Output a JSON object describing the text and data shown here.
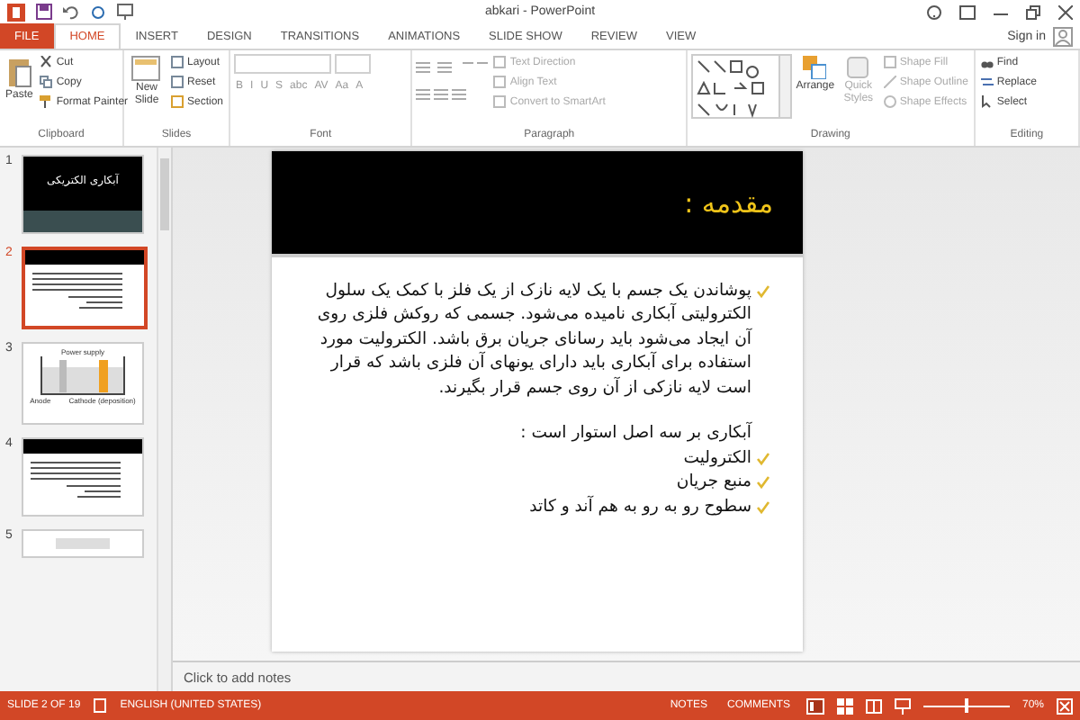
{
  "window": {
    "title": "abkari - PowerPoint",
    "sign_in": "Sign in"
  },
  "tabs": [
    {
      "label": "FILE",
      "kind": "file",
      "selected": false
    },
    {
      "label": "HOME",
      "kind": "tab",
      "selected": true
    },
    {
      "label": "INSERT",
      "kind": "tab",
      "selected": false
    },
    {
      "label": "DESIGN",
      "kind": "tab",
      "selected": false
    },
    {
      "label": "TRANSITIONS",
      "kind": "tab",
      "selected": false
    },
    {
      "label": "ANIMATIONS",
      "kind": "tab",
      "selected": false
    },
    {
      "label": "SLIDE SHOW",
      "kind": "tab",
      "selected": false
    },
    {
      "label": "REVIEW",
      "kind": "tab",
      "selected": false
    },
    {
      "label": "VIEW",
      "kind": "tab",
      "selected": false
    }
  ],
  "ribbon": {
    "clipboard": {
      "label": "Clipboard",
      "paste": "Paste",
      "cut": "Cut",
      "copy": "Copy",
      "format_painter": "Format Painter"
    },
    "slides": {
      "label": "Slides",
      "new_slide": "New Slide",
      "layout": "Layout",
      "reset": "Reset",
      "section": "Section"
    },
    "font": {
      "label": "Font",
      "buttons": [
        "B",
        "I",
        "U",
        "S",
        "abc",
        "AV",
        "Aa",
        "A"
      ]
    },
    "paragraph": {
      "label": "Paragraph",
      "text_direction": "Text Direction",
      "align_text": "Align Text",
      "convert": "Convert to SmartArt"
    },
    "drawing": {
      "label": "Drawing",
      "arrange": "Arrange",
      "quick_styles": "Quick Styles",
      "shape_fill": "Shape Fill",
      "shape_outline": "Shape Outline",
      "shape_effects": "Shape Effects"
    },
    "editing": {
      "label": "Editing",
      "find": "Find",
      "replace": "Replace",
      "select": "Select"
    }
  },
  "thumbnails": [
    {
      "number": "1",
      "kind": "title",
      "title": "آبکاری الکتریکی",
      "selected": false
    },
    {
      "number": "2",
      "kind": "text",
      "selected": true
    },
    {
      "number": "3",
      "kind": "diagram",
      "labels": [
        "Power supply",
        "Anode",
        "Cathode (deposition)"
      ],
      "selected": false
    },
    {
      "number": "4",
      "kind": "text",
      "selected": false
    },
    {
      "number": "5",
      "kind": "partial",
      "selected": false
    }
  ],
  "slide": {
    "title": "مقدمه :",
    "body": [
      {
        "kind": "check",
        "text": "پوشاندن یک جسم با یک لایه نازک از یک فلز با کمک یک سلول الکترولیتی آبکاری نامیده می‌شود. جسمی که روکش فلزی روی آن ایجاد می‌شود باید رسانای جریان برق باشد. الکترولیت مورد استفاده برای آبکاری باید دارای یونهای آن فلزی باشد که قرار است لایه نازکی از آن روی جسم قرار بگیرند."
      },
      {
        "kind": "plain",
        "text": "آبکاری بر سه اصل استوار است :"
      },
      {
        "kind": "check",
        "text": "الکترولیت"
      },
      {
        "kind": "check",
        "text": "منبع جریان"
      },
      {
        "kind": "check",
        "text": "سطوح رو به رو به هم آند و کاتد"
      }
    ]
  },
  "notes": {
    "placeholder": "Click to add notes"
  },
  "status_bar": {
    "slide": "SLIDE 2 OF 19",
    "language": "ENGLISH (UNITED STATES)",
    "notes": "NOTES",
    "comments": "COMMENTS",
    "zoom": "70%",
    "zoom_slider": {
      "level": 0.5
    }
  }
}
